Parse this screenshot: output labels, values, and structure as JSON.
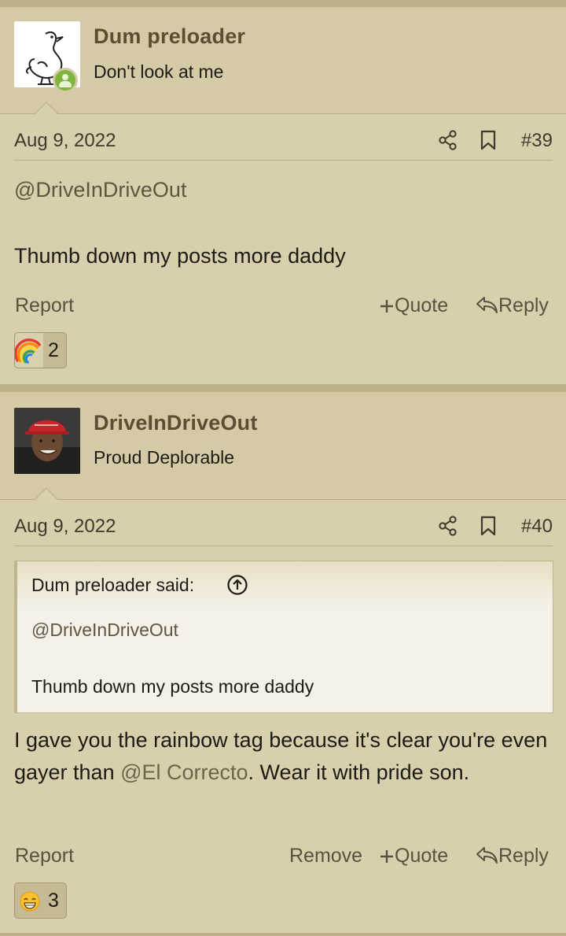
{
  "posts": [
    {
      "username": "Dum preloader",
      "user_title": "Don't look at me",
      "avatar_icon": "bird-sketch-avatar",
      "online": true,
      "date": "Aug 9, 2022",
      "post_number": "#39",
      "mention": "@DriveInDriveOut",
      "body": "Thumb down my posts more daddy",
      "actions": {
        "report": "Report",
        "quote": "Quote",
        "reply": "Reply"
      },
      "reaction": {
        "icon": "rainbow-icon",
        "count": "2"
      }
    },
    {
      "username": "DriveInDriveOut",
      "user_title": "Proud Deplorable",
      "avatar_icon": "man-red-cap-avatar",
      "date": "Aug 9, 2022",
      "post_number": "#40",
      "quote": {
        "attribution": "Dum preloader said:",
        "mention": "@DriveInDriveOut",
        "text": "Thumb down my posts more daddy"
      },
      "body_part1": "I gave you the rainbow tag because it's clear you're even gayer than ",
      "body_mention": "@El Correcto",
      "body_part2": ". Wear it with pride son.",
      "actions": {
        "report": "Report",
        "remove": "Remove",
        "quote": "Quote",
        "reply": "Reply"
      },
      "reaction": {
        "icon": "grinning-emoji-icon",
        "count": "3"
      }
    }
  ]
}
